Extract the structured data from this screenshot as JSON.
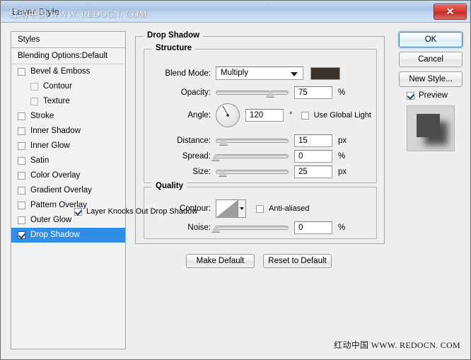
{
  "window": {
    "title": "Layer Style",
    "watermark": "红动中国 WWW. REDOCN. COM",
    "close_icon": "✕"
  },
  "styles_panel": {
    "header": "Styles",
    "blending_options": "Blending Options:Default",
    "items": [
      {
        "label": "Bevel & Emboss",
        "checked": false,
        "indent": false,
        "selected": false
      },
      {
        "label": "Contour",
        "checked": false,
        "indent": true,
        "selected": false
      },
      {
        "label": "Texture",
        "checked": false,
        "indent": true,
        "selected": false
      },
      {
        "label": "Stroke",
        "checked": false,
        "indent": false,
        "selected": false
      },
      {
        "label": "Inner Shadow",
        "checked": false,
        "indent": false,
        "selected": false
      },
      {
        "label": "Inner Glow",
        "checked": false,
        "indent": false,
        "selected": false
      },
      {
        "label": "Satin",
        "checked": false,
        "indent": false,
        "selected": false
      },
      {
        "label": "Color Overlay",
        "checked": false,
        "indent": false,
        "selected": false
      },
      {
        "label": "Gradient Overlay",
        "checked": false,
        "indent": false,
        "selected": false
      },
      {
        "label": "Pattern Overlay",
        "checked": false,
        "indent": false,
        "selected": false
      },
      {
        "label": "Outer Glow",
        "checked": false,
        "indent": false,
        "selected": false
      },
      {
        "label": "Drop Shadow",
        "checked": true,
        "indent": false,
        "selected": true
      }
    ]
  },
  "buttons": {
    "ok": "OK",
    "cancel": "Cancel",
    "new_style": "New Style...",
    "preview_label": "Preview",
    "preview_checked": true,
    "make_default": "Make Default",
    "reset_to_default": "Reset to Default"
  },
  "drop_shadow": {
    "title": "Drop Shadow",
    "structure": {
      "title": "Structure",
      "blend_mode_label": "Blend Mode:",
      "blend_mode_value": "Multiply",
      "shadow_color": "#3b322a",
      "opacity_label": "Opacity:",
      "opacity_value": "75",
      "opacity_unit": "%",
      "opacity_pct": 75,
      "angle_label": "Angle:",
      "angle_value": "120",
      "angle_unit": "°",
      "use_global_light_label": "Use Global Light",
      "use_global_light_checked": false,
      "distance_label": "Distance:",
      "distance_value": "15",
      "distance_unit": "px",
      "distance_pct": 11,
      "spread_label": "Spread:",
      "spread_value": "0",
      "spread_unit": "%",
      "spread_pct": 0,
      "size_label": "Size:",
      "size_value": "25",
      "size_unit": "px",
      "size_pct": 10
    },
    "quality": {
      "title": "Quality",
      "contour_label": "Contour:",
      "anti_aliased_label": "Anti-aliased",
      "anti_aliased_checked": false,
      "noise_label": "Noise:",
      "noise_value": "0",
      "noise_unit": "%",
      "noise_pct": 0
    },
    "knockout_label": "Layer Knocks Out Drop Shadow",
    "knockout_checked": true
  },
  "footer": {
    "watermark": "红动中国 WWW. REDOCN. COM"
  }
}
